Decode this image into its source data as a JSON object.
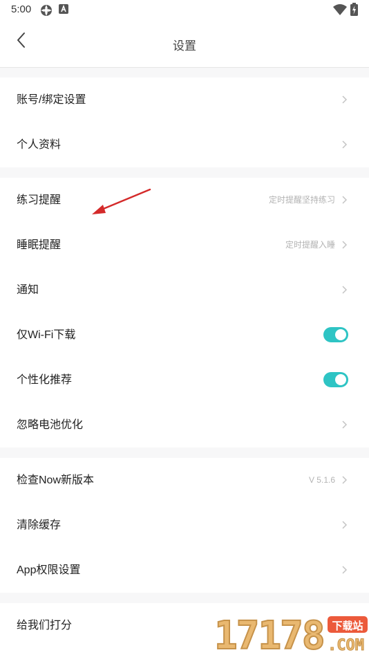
{
  "status_bar": {
    "time": "5:00"
  },
  "header": {
    "title": "设置"
  },
  "sections": [
    {
      "items": [
        {
          "label": "账号/绑定设置",
          "value": "",
          "control": "chevron"
        },
        {
          "label": "个人资料",
          "value": "",
          "control": "chevron"
        }
      ]
    },
    {
      "items": [
        {
          "label": "练习提醒",
          "value": "定时提醒坚持练习",
          "control": "chevron"
        },
        {
          "label": "睡眠提醒",
          "value": "定时提醒入睡",
          "control": "chevron"
        },
        {
          "label": "通知",
          "value": "",
          "control": "chevron"
        },
        {
          "label": "仅Wi-Fi下载",
          "value": "",
          "control": "toggle",
          "on": true
        },
        {
          "label": "个性化推荐",
          "value": "",
          "control": "toggle",
          "on": true
        },
        {
          "label": "忽略电池优化",
          "value": "",
          "control": "chevron"
        }
      ]
    },
    {
      "items": [
        {
          "label": "检查Now新版本",
          "value": "V 5.1.6",
          "control": "chevron"
        },
        {
          "label": "清除缓存",
          "value": "",
          "control": "chevron"
        },
        {
          "label": "App权限设置",
          "value": "",
          "control": "chevron"
        }
      ]
    },
    {
      "items": [
        {
          "label": "给我们打分",
          "value": "",
          "control": "none"
        }
      ]
    }
  ],
  "watermark": {
    "digits": "17178",
    "badge": "下载站",
    "suffix": ".COM"
  },
  "colors": {
    "toggle_on": "#2ec4c4",
    "arrow": "#d42a2a",
    "chevron": "#c4c4c4"
  },
  "icons": [
    "settings-app-icon",
    "a-notification-icon",
    "wifi-icon",
    "battery-charging-icon",
    "back-chevron-icon",
    "chevron-right-icon",
    "red-arrow-annotation"
  ]
}
